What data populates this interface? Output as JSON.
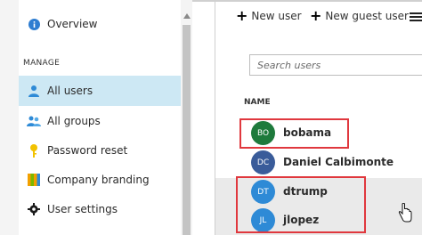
{
  "sidebar": {
    "overview": "Overview",
    "manage_header": "MANAGE",
    "items": [
      {
        "label": "All users",
        "icon": "user-icon",
        "active": true
      },
      {
        "label": "All groups",
        "icon": "groups-icon",
        "active": false
      },
      {
        "label": "Password reset",
        "icon": "key-icon",
        "active": false
      },
      {
        "label": "Company branding",
        "icon": "branding-icon",
        "active": false
      },
      {
        "label": "User settings",
        "icon": "gear-icon",
        "active": false
      }
    ]
  },
  "toolbar": {
    "new_user": "New user",
    "new_guest_user": "New guest user"
  },
  "search": {
    "placeholder": "Search users"
  },
  "table": {
    "column_name": "NAME",
    "users": [
      {
        "initials": "BO",
        "name": "bobama",
        "color": "#1e7a3c"
      },
      {
        "initials": "DC",
        "name": "Daniel Calbimonte",
        "color": "#3a5c9a"
      },
      {
        "initials": "DT",
        "name": "dtrump",
        "color": "#2e8ad6"
      },
      {
        "initials": "JL",
        "name": "jlopez",
        "color": "#2e8ad6"
      }
    ]
  },
  "colors": {
    "accent": "#0078d4",
    "active_item_bg": "#cde8f4",
    "highlight": "#e0383e"
  }
}
